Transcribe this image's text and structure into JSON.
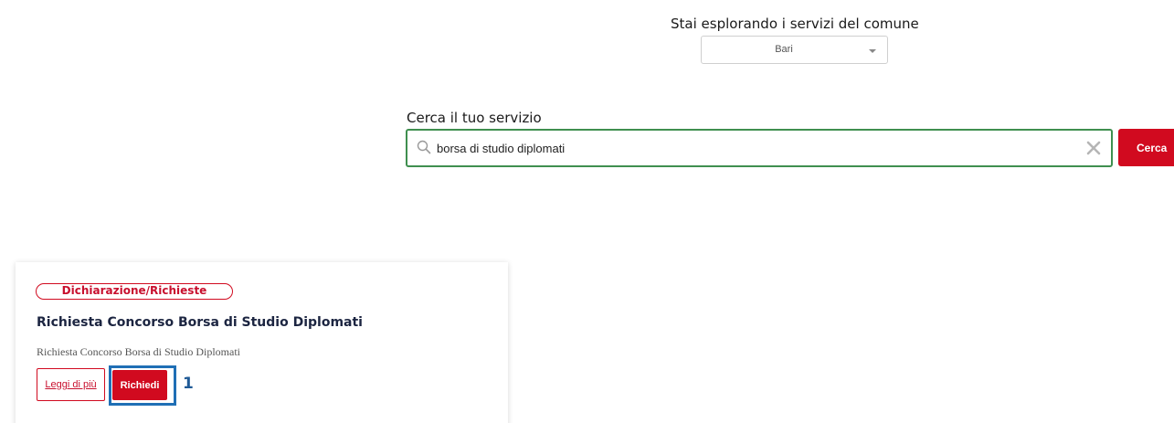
{
  "comune": {
    "label": "Stai esplorando i servizi del comune",
    "selected": "Bari"
  },
  "search": {
    "label": "Cerca il tuo servizio",
    "value": "borsa di studio diplomati",
    "button_label": "Cerca"
  },
  "card": {
    "badge": "Dichiarazione/Richieste",
    "title": "Richiesta Concorso Borsa di Studio Diplomati",
    "description": "Richiesta Concorso Borsa di Studio Diplomati",
    "read_more_label": "Leggi di più",
    "request_label": "Richiedi"
  },
  "annotation": {
    "step_number": "1"
  },
  "colors": {
    "accent_red": "#d10a1f",
    "focus_green": "#3f8f4f",
    "annotation_blue": "#1f6fb5"
  },
  "icons": {
    "search": "search-icon",
    "clear": "clear-icon",
    "dropdown": "chevron-down-icon"
  }
}
